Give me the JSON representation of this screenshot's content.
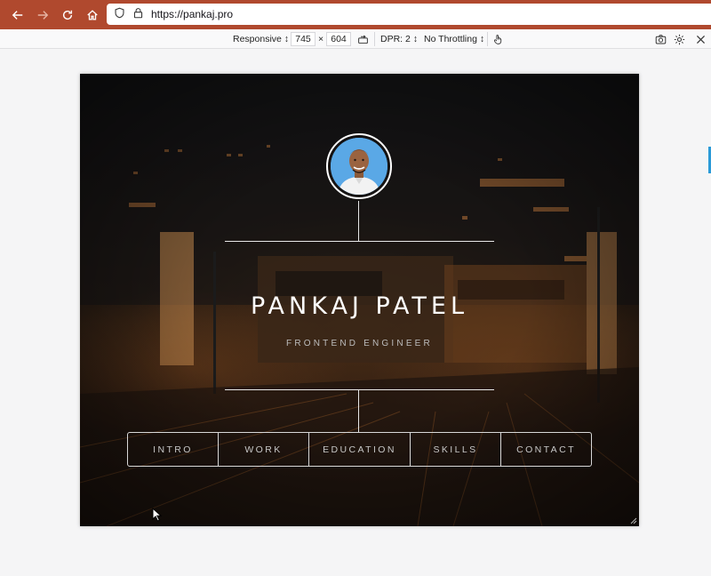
{
  "browser": {
    "url": "https://pankaj.pro",
    "accent": "#b0492e"
  },
  "rdm": {
    "device": "Responsive ↕",
    "width": "745",
    "times": "×",
    "height": "604",
    "dpr": "DPR: 2 ↕",
    "throttling": "No Throttling ↕"
  },
  "site": {
    "name": "PANKAJ PATEL",
    "role": "FRONTEND ENGINEER",
    "menu": [
      {
        "label": "INTRO"
      },
      {
        "label": "WORK"
      },
      {
        "label": "EDUCATION"
      },
      {
        "label": "SKILLS"
      },
      {
        "label": "CONTACT"
      }
    ]
  }
}
